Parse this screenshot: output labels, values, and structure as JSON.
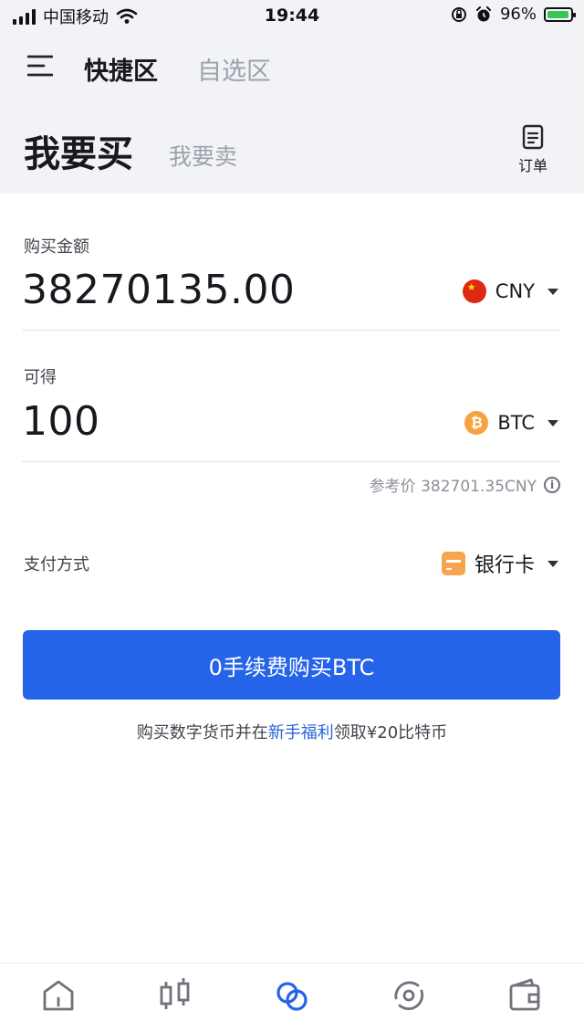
{
  "status_bar": {
    "carrier": "中国移动",
    "time": "19:44",
    "battery": "96%"
  },
  "nav": {
    "tabs": [
      {
        "label": "快捷区",
        "active": true
      },
      {
        "label": "自选区",
        "active": false
      }
    ]
  },
  "trade_tabs": {
    "buy": "我要买",
    "sell": "我要卖",
    "orders": "订单"
  },
  "form": {
    "amount_label": "购买金额",
    "amount_value": "38270135.00",
    "amount_currency": "CNY",
    "receive_label": "可得",
    "receive_value": "100",
    "receive_currency": "BTC",
    "reference_price": "参考价 382701.35CNY",
    "payment_label": "支付方式",
    "payment_method": "银行卡"
  },
  "buy_button": "0手续费购买BTC",
  "promo": {
    "before": "购买数字货币并在",
    "link": "新手福利",
    "after": "领取¥20比特币"
  },
  "bottom_nav": [
    "home-icon",
    "market-icon",
    "trade-icon",
    "finance-icon",
    "wallet-icon"
  ],
  "colors": {
    "accent": "#2563e8",
    "background_top": "#f2f3f7",
    "link": "#2a63d6"
  }
}
